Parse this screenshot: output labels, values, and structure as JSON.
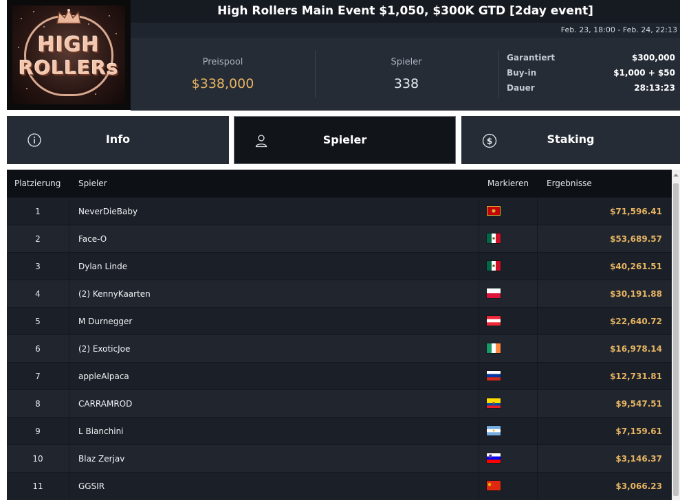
{
  "logo": {
    "line1": "HIGH",
    "line2": "ROLLERs"
  },
  "header": {
    "title": "High Rollers Main Event $1,050, $300K GTD [2day event]",
    "dates": "Feb. 23, 18:00 - Feb. 24, 22:13"
  },
  "stats": {
    "prize_pool_label": "Preispool",
    "prize_pool_value": "$338,000",
    "players_label": "Spieler",
    "players_value": "338",
    "details": [
      {
        "label": "Garantiert",
        "value": "$300,000"
      },
      {
        "label": "Buy-in",
        "value": "$1,000 + $50"
      },
      {
        "label": "Dauer",
        "value": "28:13:23"
      }
    ]
  },
  "tabs": [
    {
      "label": "Info",
      "icon": "info-icon",
      "active": false
    },
    {
      "label": "Spieler",
      "icon": "user-icon",
      "active": true
    },
    {
      "label": "Staking",
      "icon": "dollar-icon",
      "active": false
    }
  ],
  "table": {
    "headers": {
      "place": "Platzierung",
      "player": "Spieler",
      "flag": "Markieren",
      "result": "Ergebnisse"
    },
    "rows": [
      {
        "place": "1",
        "player": "NeverDieBaby",
        "flag": "ME",
        "result": "$71,596.41"
      },
      {
        "place": "2",
        "player": "Face-O",
        "flag": "MX",
        "result": "$53,689.57"
      },
      {
        "place": "3",
        "player": "Dylan Linde",
        "flag": "MX",
        "result": "$40,261.51"
      },
      {
        "place": "4",
        "player": "(2) KennyKaarten",
        "flag": "PL",
        "result": "$30,191.88"
      },
      {
        "place": "5",
        "player": "M Durnegger",
        "flag": "AT",
        "result": "$22,640.72"
      },
      {
        "place": "6",
        "player": "(2) ExoticJoe",
        "flag": "IE",
        "result": "$16,978.14"
      },
      {
        "place": "7",
        "player": "appleAlpaca",
        "flag": "RU",
        "result": "$12,731.81"
      },
      {
        "place": "8",
        "player": "CARRAMROD",
        "flag": "EC",
        "result": "$9,547.51"
      },
      {
        "place": "9",
        "player": "L Bianchini",
        "flag": "AR",
        "result": "$7,159.61"
      },
      {
        "place": "10",
        "player": "Blaz Zerjav",
        "flag": "SI",
        "result": "$3,146.37"
      },
      {
        "place": "11",
        "player": "GGSIR",
        "flag": "CN",
        "result": "$3,066.23"
      }
    ]
  },
  "colors": {
    "gold": "#e6b462",
    "panel": "#262c36",
    "dark": "#111418"
  }
}
